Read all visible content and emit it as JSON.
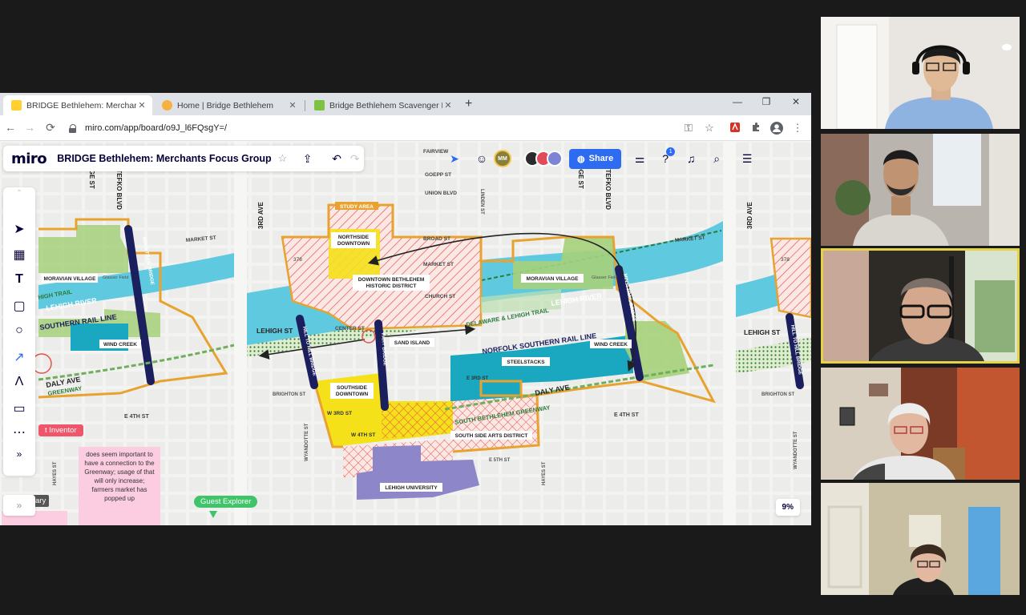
{
  "browser": {
    "tabs": [
      {
        "title": "BRIDGE Bethlehem: Merchants F...",
        "favicon_color": "#ffd02f",
        "active": true
      },
      {
        "title": "Home | Bridge Bethlehem",
        "favicon_color": "#f5b041",
        "active": false
      },
      {
        "title": "Bridge Bethlehem Scavenger Hu...",
        "favicon_color": "#7dc242",
        "active": false
      }
    ],
    "new_tab": "+",
    "window": {
      "minimize": "—",
      "restore": "❐",
      "close": "✕"
    },
    "nav": {
      "back": "←",
      "forward": "→",
      "reload": "⟳"
    },
    "url": "miro.com/app/board/o9J_l6FQsgY=/"
  },
  "miro": {
    "logo": "miro",
    "board_title": "BRIDGE Bethlehem: Merchants Focus Group",
    "share_label": "Share",
    "notification_count": "1",
    "zoom": "9%",
    "avatar_initials": "MM"
  },
  "board": {
    "sticky_note": "does seem important to have a connection to the Greenway; usage of that will only increase; farmers market has popped up",
    "guest_badge": "Guest Explorer",
    "inventor_badge": "t Inventor",
    "edge_label": "ary",
    "map": {
      "study_area": "STUDY AREA",
      "northside_downtown": "NORTHSIDE DOWNTOWN",
      "downtown_historic": "DOWNTOWN BETHLEHEM HISTORIC DISTRICT",
      "moravian_village": "MORAVIAN VILLAGE",
      "sand_island": "SAND ISLAND",
      "wind_creek": "WIND CREEK",
      "steelstacks": "STEELSTACKS",
      "southside_downtown": "SOUTHSIDE DOWNTOWN",
      "south_side_arts": "SOUTH SIDE ARTS DISTRICT",
      "lehigh_university": "LEHIGH UNIVERSITY",
      "lehigh_river": "LEHIGH RIVER",
      "norfolk_rail": "NORFOLK SOUTHERN RAIL LINE",
      "southern_rail": "SOUTHERN RAIL LINE",
      "delaware_trail": "DELAWARE & LEHIGH TRAIL",
      "high_trail": "HIGH TRAIL",
      "greenway": "SOUTH BETHLEHEM GREENWAY",
      "greenway_short": "GREENWAY",
      "minsi_bridge": "MINSI TRAIL BRIDGE",
      "hill_bridge": "HILL TO HILL BRIDGE",
      "fahy_bridge": "FAHY BRIDGE",
      "lehigh_st": "LEHIGH ST",
      "daly_ave": "DALY AVE",
      "market_st": "MARKET ST",
      "broad_st": "BROAD ST",
      "union_blvd": "UNION BLVD",
      "church_st": "CHURCH ST",
      "center_st": "CENTER ST",
      "e_4th_st": "E 4TH ST",
      "w_3rd_st": "W 3RD ST",
      "w_4th_st": "W 4TH ST",
      "e_3rd_st": "E 3RD ST",
      "e_5th_st": "E 5TH ST",
      "third_ave": "3RD AVE",
      "stefko_blvd": "STEFKO BLVD",
      "brighton_st": "BRIGHTON ST",
      "wyandotte_st": "WYANDOTTE ST",
      "hayes_st": "HAYES ST",
      "goepp_st": "GOEPP ST",
      "fairview": "FAIRVIEW",
      "linden_st": "LINDEN ST",
      "route_378": "378",
      "glasser_field": "Glasser Field",
      "ridge_st": "DGE ST"
    }
  },
  "colors": {
    "orange_boundary": "#e8a230",
    "river": "#5fc9e0",
    "teal_industrial": "#1aa7c0",
    "park_green": "#a6d07a",
    "southside_yellow": "#f5e11a",
    "lehigh_purple": "#8d86c9",
    "bridge_navy": "#1b1f5e",
    "hatch_red": "#e5534b",
    "share_blue": "#2d6cf0"
  }
}
